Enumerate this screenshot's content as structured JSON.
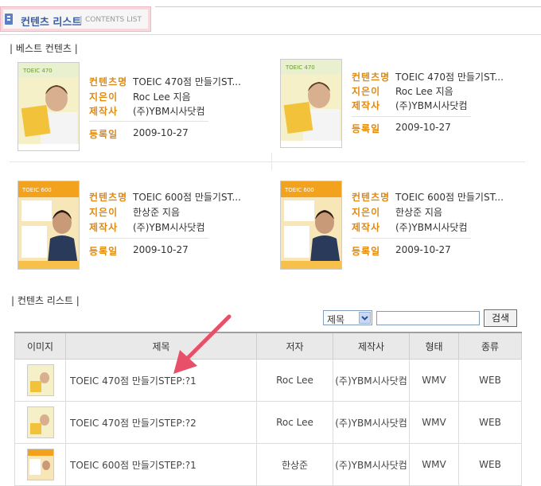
{
  "header": {
    "title": "컨텐츠 리스트",
    "separator": "|",
    "subtitle": "CONTENTS LIST"
  },
  "best_section_label": "| 베스트 컨텐츠 |",
  "best_items": [
    {
      "name_label": "컨텐츠명",
      "name": "TOEIC 470점 만들기ST...",
      "author_label": "지은이",
      "author": "Roc Lee 지음",
      "publisher_label": "제작사",
      "publisher": "(주)YBM시사닷컴",
      "date_label": "등록일",
      "date": "2009-10-27"
    },
    {
      "name_label": "컨텐츠명",
      "name": "TOEIC 470점 만들기ST...",
      "author_label": "지은이",
      "author": "Roc Lee 지음",
      "publisher_label": "제작사",
      "publisher": "(주)YBM시사닷컴",
      "date_label": "등록일",
      "date": "2009-10-27"
    },
    {
      "name_label": "컨텐츠명",
      "name": "TOEIC 600점 만들기ST...",
      "author_label": "지은이",
      "author": "한상준 지음",
      "publisher_label": "제작사",
      "publisher": "(주)YBM시사닷컴",
      "date_label": "등록일",
      "date": "2009-10-27"
    },
    {
      "name_label": "컨텐츠명",
      "name": "TOEIC 600점 만들기ST...",
      "author_label": "지은이",
      "author": "한상준 지음",
      "publisher_label": "제작사",
      "publisher": "(주)YBM시사닷컴",
      "date_label": "등록일",
      "date": "2009-10-27"
    }
  ],
  "list_section_label": "| 컨텐츠 리스트 |",
  "search": {
    "field_selected": "제목",
    "input_value": "",
    "button_label": "검색"
  },
  "table": {
    "headers": [
      "이미지",
      "제목",
      "저자",
      "제작사",
      "형태",
      "종류"
    ],
    "rows": [
      {
        "title": "TOEIC 470점 만들기STEP:?1",
        "author": "Roc Lee",
        "publisher": "(주)YBM시사닷컴",
        "format": "WMV",
        "kind": "WEB"
      },
      {
        "title": "TOEIC 470점 만들기STEP:?2",
        "author": "Roc Lee",
        "publisher": "(주)YBM시사닷컴",
        "format": "WMV",
        "kind": "WEB"
      },
      {
        "title": "TOEIC 600점 만들기STEP:?1",
        "author": "한상준",
        "publisher": "(주)YBM시사닷컴",
        "format": "WMV",
        "kind": "WEB"
      }
    ]
  },
  "colors": {
    "accent_orange": "#e08a12",
    "header_blue": "#3a5ea8",
    "arrow_red": "#e8506a"
  }
}
